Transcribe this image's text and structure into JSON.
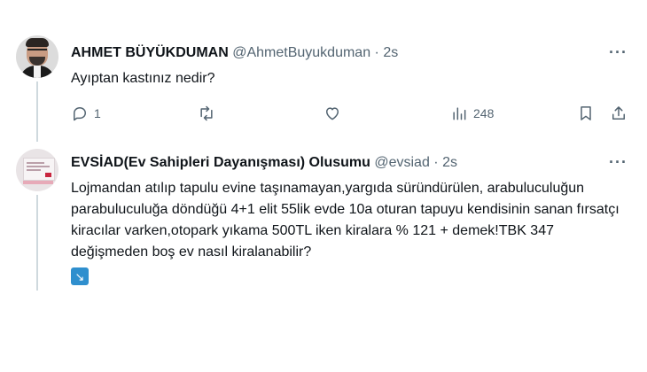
{
  "tweets": [
    {
      "name": "AHMET BÜYÜKDUMAN",
      "handle": "@AhmetBuyukduman",
      "time": "· 2s",
      "text": "Ayıptan kastınız nedir?",
      "replies": "1",
      "views": "248"
    },
    {
      "name": "EVSİAD(Ev Sahipleri Dayanışması) Olusumu",
      "handle": "@evsiad",
      "time": "· 2s",
      "text": "Lojmandan atılıp tapulu evine taşınamayan,yargıda süründürülen, arabuluculuğun parabuluculuğa döndüğü 4+1 elit 55lik evde 10a oturan tapuyu kendisinin sanan fırsatçı kiracılar varken,otopark yıkama 500TL iken kiralara % 121 + demek!TBK 347 değişmeden boş ev nasıl kiralanabilir?",
      "badge": "↘"
    }
  ],
  "icons": {
    "more": "more-dots-icon",
    "reply": "reply-icon",
    "retweet": "retweet-icon",
    "like": "like-icon",
    "views": "views-icon",
    "bookmark": "bookmark-icon",
    "share": "share-icon",
    "link_badge": "arrow-turn-down-right-icon"
  },
  "colors": {
    "text": "#0f1419",
    "secondary": "#536471",
    "thread_line": "#cfd9de",
    "badge": "#2f8fce"
  }
}
